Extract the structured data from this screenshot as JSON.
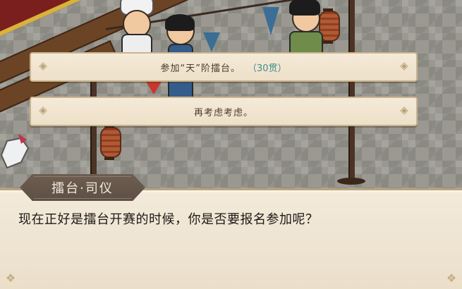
{
  "choices": [
    {
      "text": "参加“天”阶擂台。",
      "cost": "（30贯）"
    },
    {
      "text": "再考虑考虑。",
      "cost": ""
    }
  ],
  "dialogue": {
    "speaker": "擂台·司仪",
    "text": "现在正好是擂台开赛的时候，你是否要报名参加呢？"
  },
  "colors": {
    "panel": "#f4ead8",
    "panel_border": "#c9b48e",
    "cost": "#3f8f8a",
    "nameplate": "#6e5e51"
  },
  "icons": {
    "choice_ornament": "diamond-ornament-icon",
    "dialog_corner": "corner-ornament-icon"
  }
}
